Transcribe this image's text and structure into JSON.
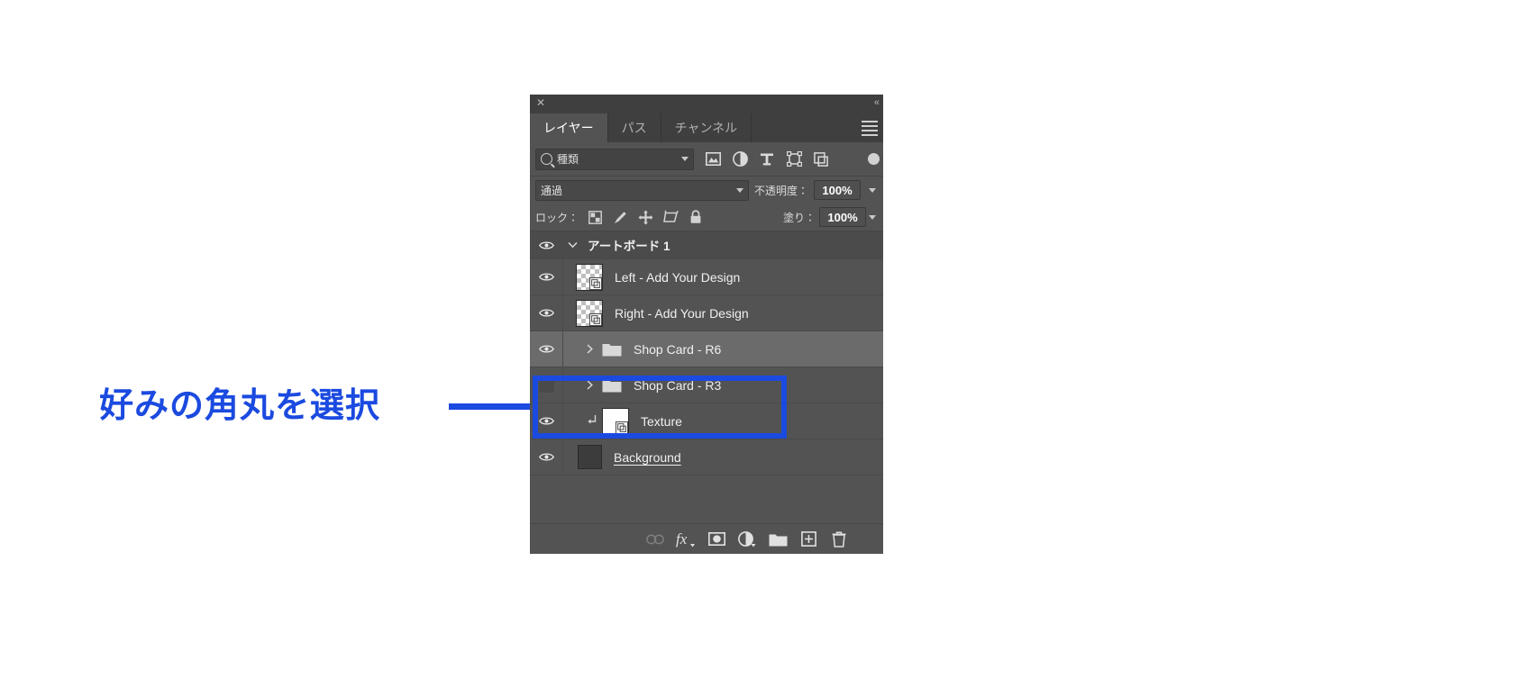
{
  "annotation": {
    "text": "好みの角丸を選択",
    "color": "#1b4ae0",
    "line_name": "callout-line",
    "box_name": "callout-highlight-box"
  },
  "panel": {
    "titlebar": {
      "close_glyph": "✕",
      "collapse_glyph": "«"
    },
    "tabs": [
      {
        "label": "レイヤー",
        "active": true
      },
      {
        "label": "パス",
        "active": false
      },
      {
        "label": "チャンネル",
        "active": false
      }
    ],
    "filter_row": {
      "search_icon": "search-icon",
      "kind_label": "種類",
      "caret": "chevron-down-icon",
      "icons": [
        "image-filter-icon",
        "adjustment-filter-icon",
        "type-filter-icon",
        "shape-filter-icon",
        "smart-object-filter-icon"
      ],
      "toggle_name": "filter-enable-toggle"
    },
    "blend_row": {
      "blend_mode": "通過",
      "opacity_label": "不透明度：",
      "opacity_value": "100%"
    },
    "lock_row": {
      "lock_label": "ロック：",
      "icons": [
        "lock-transparency-icon",
        "lock-image-icon",
        "lock-position-icon",
        "lock-artboard-icon",
        "lock-all-icon"
      ],
      "fill_label": "塗り：",
      "fill_value": "100%"
    },
    "layers": [
      {
        "name": "アートボード 1",
        "type": "artboard",
        "visible": true,
        "expanded": true,
        "selected": false
      },
      {
        "name": "Left - Add Your Design",
        "type": "smart-object",
        "visible": true,
        "selected": false
      },
      {
        "name": "Right - Add Your Design",
        "type": "smart-object",
        "visible": true,
        "selected": false
      },
      {
        "name": "Shop Card - R6",
        "type": "group",
        "visible": true,
        "selected": true
      },
      {
        "name": "Shop Card - R3",
        "type": "group",
        "visible": false,
        "selected": false
      },
      {
        "name": "Texture",
        "type": "clipped-smart-object",
        "visible": true,
        "selected": false
      },
      {
        "name": "Background",
        "type": "background",
        "visible": true,
        "selected": false
      }
    ],
    "bottom_toolbar": [
      {
        "icon": "link-layers-icon",
        "enabled": false
      },
      {
        "icon": "layer-style-fx-icon",
        "enabled": true
      },
      {
        "icon": "layer-mask-icon",
        "enabled": true
      },
      {
        "icon": "adjustment-layer-icon",
        "enabled": true
      },
      {
        "icon": "new-group-icon",
        "enabled": true
      },
      {
        "icon": "new-layer-icon",
        "enabled": true
      },
      {
        "icon": "delete-layer-icon",
        "enabled": true
      }
    ]
  }
}
